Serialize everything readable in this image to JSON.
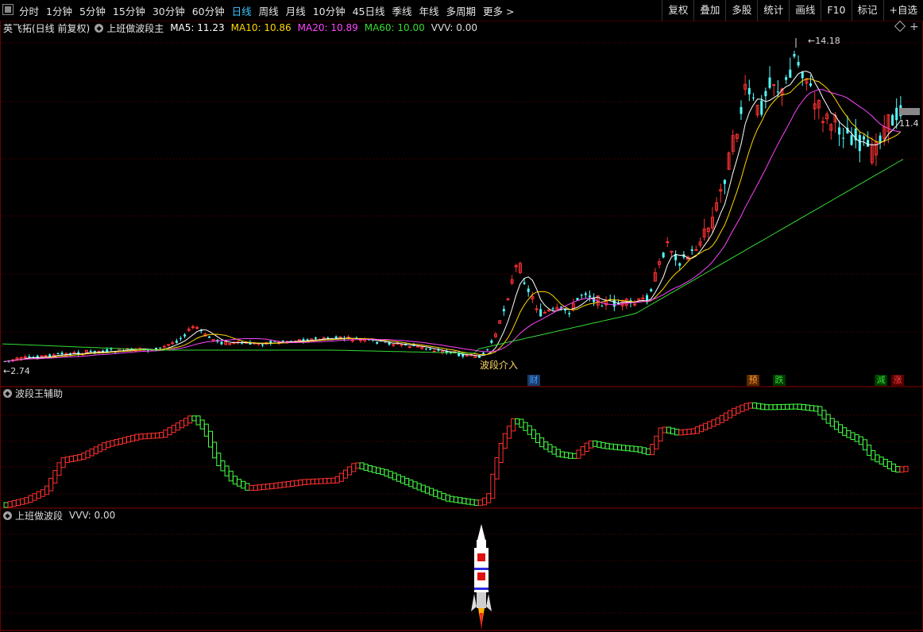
{
  "toolbar": {
    "tabs": [
      {
        "label": "分时"
      },
      {
        "label": "1分钟"
      },
      {
        "label": "5分钟"
      },
      {
        "label": "15分钟"
      },
      {
        "label": "30分钟"
      },
      {
        "label": "60分钟"
      },
      {
        "label": "日线",
        "active": true
      },
      {
        "label": "周线"
      },
      {
        "label": "月线"
      },
      {
        "label": "10分钟"
      },
      {
        "label": "45日线"
      },
      {
        "label": "季线"
      },
      {
        "label": "年线"
      },
      {
        "label": "多周期"
      },
      {
        "label": "更多 >"
      }
    ],
    "right_buttons": [
      "复权",
      "叠加",
      "多股",
      "统计",
      "画线",
      "F10",
      "标记",
      "+自选"
    ]
  },
  "main_panel": {
    "stock": "英飞拓(日线 前复权)",
    "indicator_name": "上班做波段主",
    "ma": [
      {
        "label": "MA5: 11.23",
        "color": "#ffffff"
      },
      {
        "label": "MA10: 10.86",
        "color": "#ffd700"
      },
      {
        "label": "MA20: 10.89",
        "color": "#ff44ff"
      },
      {
        "label": "MA60: 10.00",
        "color": "#33dd33"
      },
      {
        "label": "VVV: 0.00",
        "color": "#dddddd"
      }
    ],
    "high_label": "14.18",
    "low_label": "2.74",
    "current_price": "11.4",
    "entry_label": "波段介入",
    "event_markers": [
      {
        "text": "财",
        "color": "#39a0ff",
        "bg": "#1d3a6a"
      },
      {
        "text": "预",
        "color": "#ff9a3c",
        "bg": "#5a2a00"
      },
      {
        "text": "跌",
        "color": "#33dd33",
        "bg": "#003a00"
      },
      {
        "text": "減",
        "color": "#33dd33",
        "bg": "#003a00"
      },
      {
        "text": "涨",
        "color": "#ff4444",
        "bg": "#5a0000"
      }
    ],
    "colors": {
      "up": "#ff3232",
      "down": "#54ffff",
      "ma5": "#ffffff",
      "ma10": "#ffd700",
      "ma20": "#ff44ff",
      "ma60": "#33dd33"
    }
  },
  "aux_panel": {
    "title": "波段王辅助"
  },
  "bottom_panel": {
    "title": "上班做波段",
    "value": "VVV: 0.00"
  }
}
